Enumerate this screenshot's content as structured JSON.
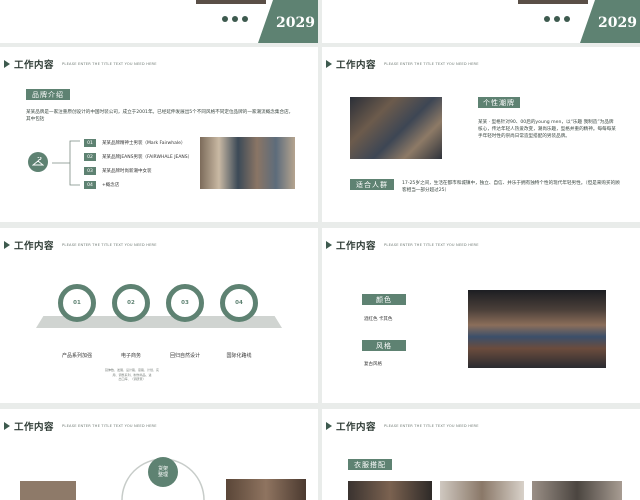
{
  "top": {
    "year_left": "2029",
    "year_right": "2029"
  },
  "header": {
    "title": "工作内容",
    "sub": "PLEASE ENTER THE TITLE TEXT YOU NEED HERE"
  },
  "s1": {
    "tag": "品牌介绍",
    "para": "某某品牌是一家注重原创设计的中国时装公司，成立于2001年。已经延伸发展出5个不同风格不同定位品牌的一家潮流概念集合店，其中包括",
    "items": [
      {
        "num": "01",
        "text": "某某品牌精神士男装（Mark Fairwhale）"
      },
      {
        "num": "02",
        "text": "某某品牌JEANS男装（FAIRWHALE JEANS）"
      },
      {
        "num": "03",
        "text": "某某品牌时尚新潮中女装"
      },
      {
        "num": "04",
        "text": "+概念店"
      }
    ]
  },
  "s2": {
    "tag1": "个性潮牌",
    "para1": "某某 · 型格针对90、00后的young men，以“乐趣 我制造”为品牌核心，传达年轻人热爱改变，潮尚乐趣，型格并重的精神。每每每某手年轻时性的崇尚日常造型搭配的男装品牌。",
    "tag2": "适合人群",
    "para2": "17-25岁之间，生活在都市和城镇中，独立、自信、并乐于拥有独特个性的现代年轻男性。（但是来购买的顾客相当一部分超过25）"
  },
  "s3": {
    "circles": [
      "01",
      "02",
      "03",
      "04"
    ],
    "labels": [
      "产品系列加强",
      "电子商务",
      "回归自然设计",
      "国际化路线"
    ],
    "note": "延伸数、发展、设计路、思路、计划、实 \n 用、调整系列、制作商品、进 \n 出口库、（调研意）"
  },
  "s4": {
    "tag1": "颜色",
    "v1": "酒红色 卡其色",
    "tag2": "风格",
    "v2": "复古风格"
  },
  "s5": {
    "badge": "货架 \n 整理"
  },
  "s6": {
    "tag": "衣服搭配"
  },
  "colors": {
    "accent": "#5e8272",
    "dark": "#3d5a4e"
  }
}
